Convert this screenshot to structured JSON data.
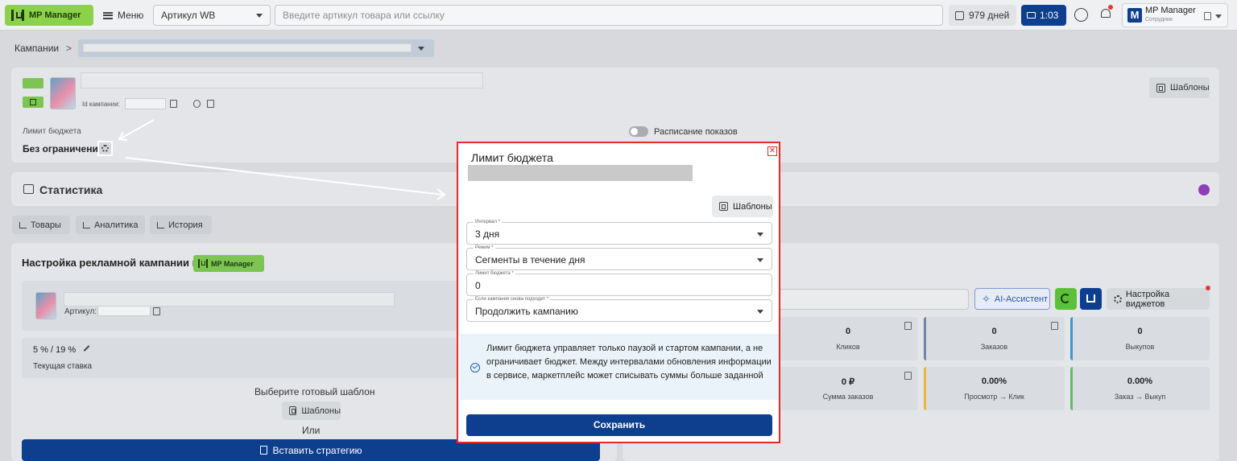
{
  "topbar": {
    "logo": "MP Manager",
    "menu_label": "Меню",
    "marketplace_select": "Артикул WB",
    "search_placeholder": "Введите артикул товара или ссылку",
    "days_label": "979 дней",
    "timer_label": "1:03",
    "profile_name": "MP Manager",
    "profile_role": "Сотрудник",
    "avatar_letter": "M"
  },
  "breadcrumb": {
    "root": "Кампании",
    "separator": ">"
  },
  "campaign": {
    "id_label": "Id кампании:",
    "budget_label": "Лимит бюджета",
    "budget_value": "Без ограничений",
    "templates_button": "Шаблоны",
    "schedule_label": "Расписание показов"
  },
  "statistics": {
    "title": "Статистика"
  },
  "tabs": [
    {
      "label": "Товары"
    },
    {
      "label": "Аналитика"
    },
    {
      "label": "История"
    }
  ],
  "settings": {
    "title": "Настройка рекламной кампании в",
    "badge": "MP Manager",
    "article_label": "Артикул:",
    "rate_value": "5 % / 19 %",
    "rate_caption": "Текущая ставка",
    "choose_template": "Выберите готовый шаблон",
    "templates_button": "Шаблоны",
    "or_label": "Или",
    "insert_button": "Вставить стратегию"
  },
  "widgets": {
    "ai_button": "AI-Ассистент",
    "settings_button": "Настройка виджетов",
    "metrics": [
      {
        "value": "0",
        "label": "Кликов"
      },
      {
        "value": "0",
        "label": "Заказов"
      },
      {
        "value": "0",
        "label": "Выкупов"
      },
      {
        "value": "0 ₽",
        "label": "Сумма заказов"
      },
      {
        "value": "0.00%",
        "label": "Просмотр → Клик"
      },
      {
        "value": "0.00%",
        "label": "Заказ → Выкуп"
      }
    ]
  },
  "modal": {
    "title": "Лимит бюджета",
    "close_icon": "✕",
    "templates_button": "Шаблоны",
    "fields": [
      {
        "label": "Интервал *",
        "value": "3 дня",
        "type": "select"
      },
      {
        "label": "Режим *",
        "value": "Сегменты в течение дня",
        "type": "select"
      },
      {
        "label": "Лимит бюджета *",
        "value": "0",
        "type": "input"
      },
      {
        "label": "Если кампания снова подходит *",
        "value": "Продолжить кампанию",
        "type": "select"
      }
    ],
    "info_text": "Лимит бюджета управляет только паузой и стартом кампании, а не ограничивает бюджет. Между интервалами обновления информации в сервисе, маркетплейс может списывать суммы больше заданной",
    "save_button": "Сохранить"
  },
  "colors": {
    "brand_green": "#8bd14a",
    "primary_blue": "#0e3f8f",
    "highlight_red": "#e32b2b",
    "info_bg": "#ebf3fa"
  }
}
